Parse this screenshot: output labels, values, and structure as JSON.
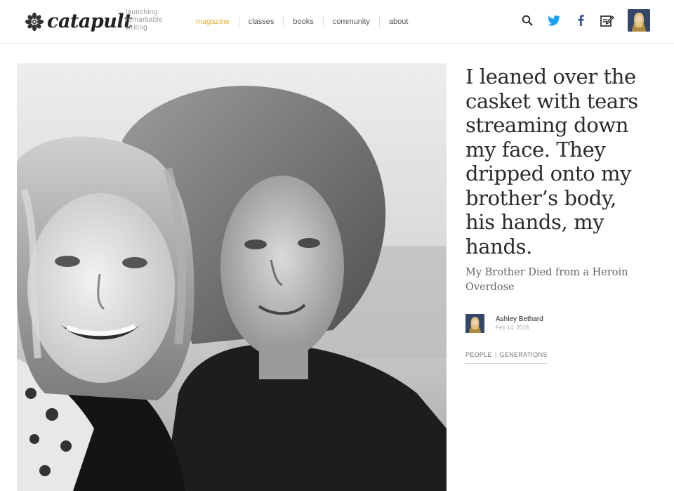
{
  "header": {
    "logo_text": "catapult",
    "tagline": [
      "launching",
      "remarkable",
      "writing"
    ],
    "nav": [
      {
        "label": "magazine",
        "active": true
      },
      {
        "label": "classes",
        "active": false
      },
      {
        "label": "books",
        "active": false
      },
      {
        "label": "community",
        "active": false
      },
      {
        "label": "about",
        "active": false
      }
    ],
    "icons": [
      "search-icon",
      "twitter-icon",
      "facebook-icon",
      "compose-icon"
    ],
    "accent_color": "#e8b339",
    "twitter_color": "#1da1f2",
    "facebook_color": "#3b5998"
  },
  "hero": {
    "image": "black-and-white selfie photo"
  },
  "article": {
    "headline": "I leaned over the casket with tears streaming down my face. They dripped onto my brother’s body, his hands, my hands.",
    "subtitle": "My Brother Died from a Heroin Overdose",
    "author_name": "Ashley Bethard",
    "date": "Feb 14, 2018",
    "tags": [
      "PEOPLE",
      "GENERATIONS"
    ],
    "tag_separator": "|"
  }
}
